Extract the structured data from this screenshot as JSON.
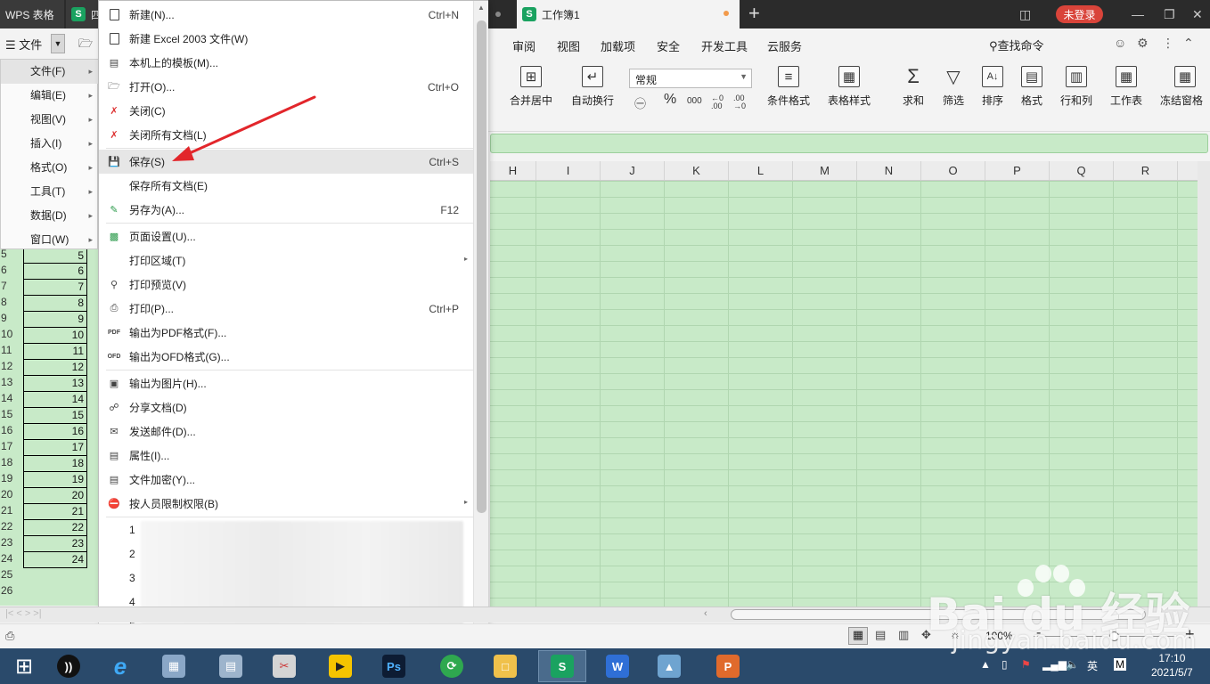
{
  "titlebar": {
    "app_tab": "WPS 表格",
    "doc_tab_fragment": "四",
    "active_tab": "工作簿1",
    "new_tab": "+",
    "login": "未登录"
  },
  "menubar": {
    "file_label": "文件",
    "ribbon_tabs": [
      "审阅",
      "视图",
      "加载项",
      "安全",
      "开发工具",
      "云服务"
    ],
    "search_command": "查找命令"
  },
  "ribbon": {
    "merge_center": "合并居中",
    "wrap_text": "自动换行",
    "number_format": "常规",
    "currency_symbol": "㊀",
    "percent_symbol": "%",
    "thousands": "000",
    "dec_inc": "←0 .00",
    "dec_dec": ".00 →0",
    "conditional_format": "条件格式",
    "table_style": "表格样式",
    "sum": "求和",
    "filter": "筛选",
    "sort": "排序",
    "format": "格式",
    "rows_cols": "行和列",
    "worksheet": "工作表",
    "freeze": "冻结窗格"
  },
  "columns": [
    "H",
    "I",
    "J",
    "K",
    "L",
    "M",
    "N",
    "O",
    "P",
    "Q",
    "R"
  ],
  "submenu": {
    "items": [
      "文件(F)",
      "编辑(E)",
      "视图(V)",
      "插入(I)",
      "格式(O)",
      "工具(T)",
      "数据(D)",
      "窗口(W)"
    ]
  },
  "rows": [
    {
      "num": "5",
      "val": "5"
    },
    {
      "num": "6",
      "val": "6"
    },
    {
      "num": "7",
      "val": "7"
    },
    {
      "num": "8",
      "val": "8"
    },
    {
      "num": "9",
      "val": "9"
    },
    {
      "num": "10",
      "val": "10"
    },
    {
      "num": "11",
      "val": "11"
    },
    {
      "num": "12",
      "val": "12"
    },
    {
      "num": "13",
      "val": "13"
    },
    {
      "num": "14",
      "val": "14"
    },
    {
      "num": "15",
      "val": "15"
    },
    {
      "num": "16",
      "val": "16"
    },
    {
      "num": "17",
      "val": "17"
    },
    {
      "num": "18",
      "val": "18"
    },
    {
      "num": "19",
      "val": "19"
    },
    {
      "num": "20",
      "val": "20"
    },
    {
      "num": "21",
      "val": "21"
    },
    {
      "num": "22",
      "val": "22"
    },
    {
      "num": "23",
      "val": "23"
    },
    {
      "num": "24",
      "val": "24"
    },
    {
      "num": "25",
      "val": ""
    },
    {
      "num": "26",
      "val": ""
    }
  ],
  "menu": {
    "items": [
      {
        "label": "新建(N)...",
        "shortcut": "Ctrl+N"
      },
      {
        "label": "新建 Excel 2003 文件(W)",
        "shortcut": ""
      },
      {
        "label": "本机上的模板(M)...",
        "shortcut": ""
      },
      {
        "label": "打开(O)...",
        "shortcut": "Ctrl+O"
      },
      {
        "label": "关闭(C)",
        "shortcut": ""
      },
      {
        "label": "关闭所有文档(L)",
        "shortcut": ""
      },
      {
        "label": "保存(S)",
        "shortcut": "Ctrl+S"
      },
      {
        "label": "保存所有文档(E)",
        "shortcut": ""
      },
      {
        "label": "另存为(A)...",
        "shortcut": "F12"
      },
      {
        "label": "页面设置(U)...",
        "shortcut": ""
      },
      {
        "label": "打印区域(T)",
        "shortcut": ""
      },
      {
        "label": "打印预览(V)",
        "shortcut": ""
      },
      {
        "label": "打印(P)...",
        "shortcut": "Ctrl+P"
      },
      {
        "label": "输出为PDF格式(F)...",
        "shortcut": ""
      },
      {
        "label": "输出为OFD格式(G)...",
        "shortcut": ""
      },
      {
        "label": "输出为图片(H)...",
        "shortcut": ""
      },
      {
        "label": "分享文档(D)",
        "shortcut": ""
      },
      {
        "label": "发送邮件(D)...",
        "shortcut": ""
      },
      {
        "label": "属性(I)...",
        "shortcut": ""
      },
      {
        "label": "文件加密(Y)...",
        "shortcut": ""
      },
      {
        "label": "按人员限制权限(B)",
        "shortcut": ""
      }
    ],
    "recent_numbers": [
      "1",
      "2",
      "3",
      "4",
      "5"
    ]
  },
  "statusbar": {
    "zoom": "100%",
    "zoom_minus": "-",
    "zoom_plus": "+"
  },
  "taskbar": {
    "tray_lang": "英",
    "tray_ime": "M",
    "time": "17:10",
    "date": "2021/5/7"
  },
  "watermark": {
    "brand": "Bai du 经验",
    "url": "jingyan.baidu.com"
  },
  "colors": {
    "grid_green": "#c8eac8",
    "accent_red": "#e2262b",
    "wps_green": "#1aa260",
    "taskbar": "#2a4a6b"
  }
}
